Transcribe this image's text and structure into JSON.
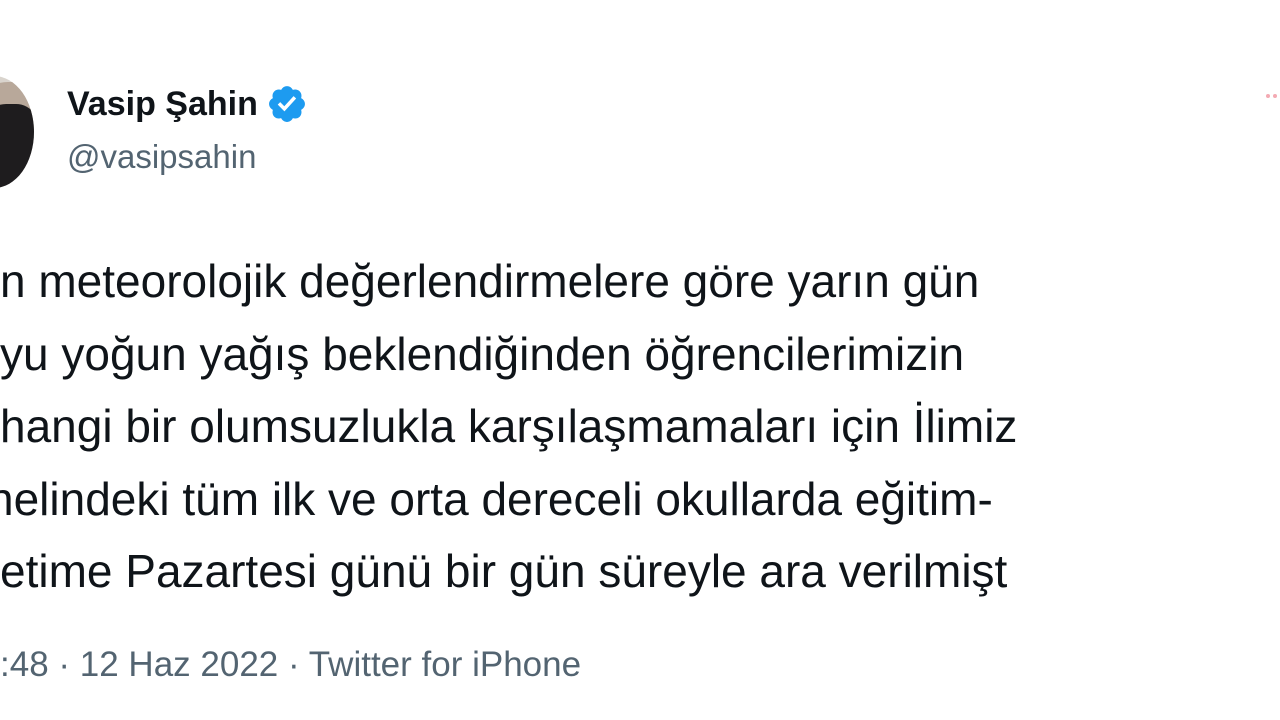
{
  "tweet": {
    "author": {
      "name": "Vasip Şahin",
      "handle": "@vasipsahin",
      "verified": true
    },
    "text_lines": [
      "n meteorolojik değerlendirmelere göre yarın gün",
      "yu yoğun yağış beklendiğinden öğrencilerimizin",
      "hangi bir olumsuzlukla karşılaşmamaları için İlimiz",
      "nelindeki tüm ilk ve orta dereceli okullarda eğitim-",
      "etime Pazartesi günü bir gün süreyle ara verilmişt"
    ],
    "meta": {
      "time": ":48",
      "separator": " · ",
      "date": "12 Haz 2022",
      "source": "Twitter for iPhone"
    }
  },
  "colors": {
    "verified_badge": "#1d9bf0",
    "text_primary": "#0f1419",
    "text_secondary": "#536471"
  },
  "icons": {
    "verified": "verified-badge-icon",
    "more": "more-options-icon"
  }
}
